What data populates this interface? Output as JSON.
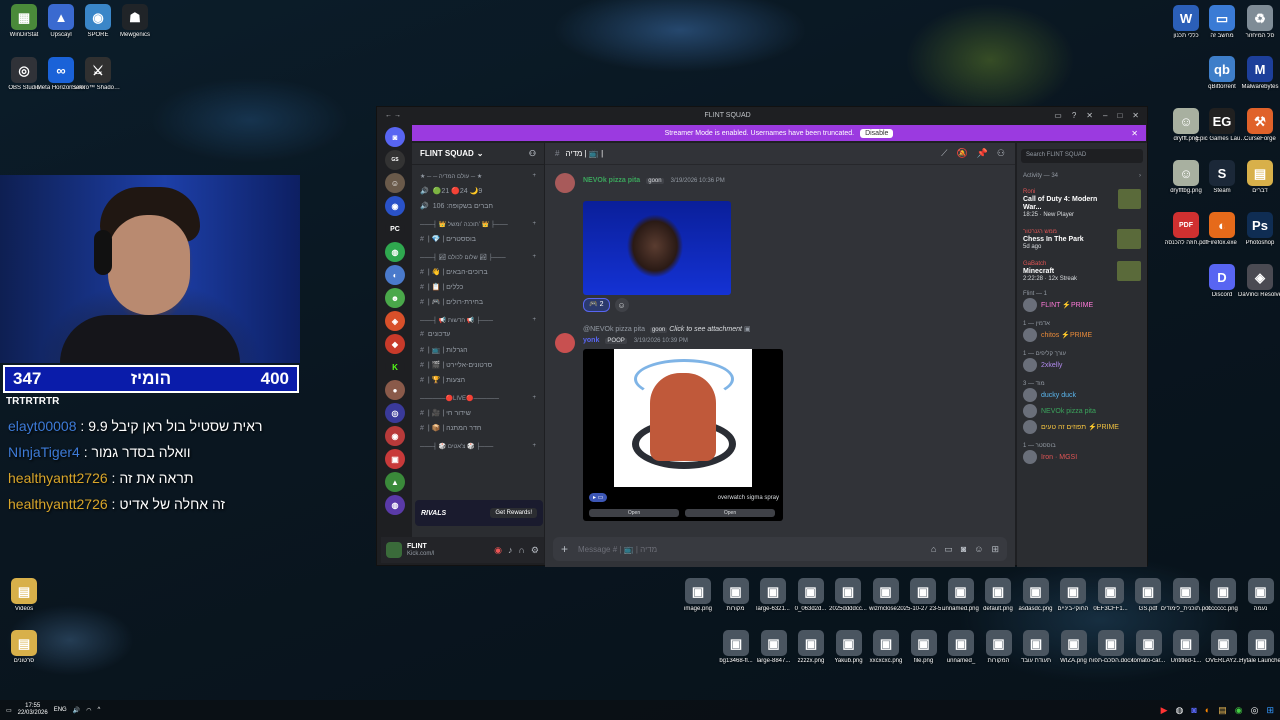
{
  "desktop_left": [
    {
      "label": "WinDirStat",
      "color": "#4a8a3a",
      "glyph": "▦"
    },
    {
      "label": "Upscayl",
      "color": "#3a6ad0",
      "glyph": "▲"
    },
    {
      "label": "SPORE",
      "color": "#3a86c8",
      "glyph": "◉"
    },
    {
      "label": "Mewgenics",
      "color": "#202428",
      "glyph": "☗"
    }
  ],
  "desktop_left_row2": [
    {
      "label": "OBS Studio",
      "color": "#303238",
      "glyph": "◎"
    },
    {
      "label": "Meta Horizon Link",
      "color": "#1a62d8",
      "glyph": "∞"
    },
    {
      "label": "Sekiro™ Shadows D...",
      "color": "#303030",
      "glyph": "⚔"
    }
  ],
  "desktop_left_bottom": [
    {
      "label": "Videos",
      "color": "#d8b04a",
      "glyph": "▤"
    },
    {
      "label": "סרטונים",
      "color": "#d8b04a",
      "glyph": "▤"
    }
  ],
  "desktop_right": [
    {
      "label": "כללי תכנון",
      "color": "#2b5fb8",
      "glyph": "W"
    },
    {
      "label": "מחשב זה",
      "color": "#3a7bd5",
      "glyph": "▭"
    },
    {
      "label": "סל המיחזור",
      "color": "#7f8c96",
      "glyph": "♻"
    },
    {
      "label": "qBittorrent",
      "color": "#3e7ec9",
      "glyph": "qb"
    },
    {
      "label": "Malwarebytes",
      "color": "#1d3f9a",
      "glyph": "M"
    },
    {
      "label": "dryfft.png",
      "color": "#a8b0a0",
      "glyph": "☺"
    },
    {
      "label": "Epic Games Launcher",
      "color": "#202020",
      "glyph": "EG"
    },
    {
      "label": "CurseForge",
      "color": "#e0622a",
      "glyph": "⚒"
    },
    {
      "label": "dryfftbg.png",
      "color": "#a8b0a0",
      "glyph": "☺"
    },
    {
      "label": "Steam",
      "color": "#1b2838",
      "glyph": "S"
    },
    {
      "label": "דברים",
      "color": "#d8b04a",
      "glyph": "▤"
    },
    {
      "label": "חוזה להכנסה.pdf",
      "color": "#d03030",
      "glyph": "PDF"
    },
    {
      "label": "Firefox.exe",
      "color": "#e66a1a",
      "glyph": "◐"
    },
    {
      "label": "Photoshop",
      "color": "#0f2d53",
      "glyph": "Ps"
    },
    {
      "label": "Discord",
      "color": "#5865f2",
      "glyph": "D"
    },
    {
      "label": "DaVinci Resolve",
      "color": "#4a4a52",
      "glyph": "◈"
    }
  ],
  "webcam": {
    "score_left": "347",
    "score_right": "400",
    "score_title": "הומיז",
    "tag": "TRTRTRTR"
  },
  "chat_lines": [
    {
      "user": "elayt00008",
      "color": "#3d7bd8",
      "text": " : ראית שסטיל בול ראן קיבל 9.9"
    },
    {
      "user": "NInjaTiger4",
      "color": "#3d7bd8",
      "text": " : וואלה בסדר גמור"
    },
    {
      "user": "healthyantt2726",
      "color": "#d8a52a",
      "text": " : תראה את זה"
    },
    {
      "user": "healthyantt2726",
      "color": "#d8a52a",
      "text": " : זה אחלה של אדיט"
    }
  ],
  "discord": {
    "window_title": "FLINT SQUAD",
    "banner_text": "Streamer Mode is enabled. Usernames have been truncated.",
    "banner_button": "Disable",
    "server_name": "FLINT SQUAD",
    "channel_header": "מדיה | 📺 |",
    "search_placeholder": "Search FLINT SQUAD",
    "composer_placeholder": "Message # | 📺 | מדיה",
    "categories": [
      {
        "name": "★ ─ ─ עולם המדיה ─ ★",
        "channels": [
          {
            "name": "🟢21 🔴24 🌙9",
            "type": "voice"
          },
          {
            "name": "חברים בשקופה: 106",
            "type": "voice"
          }
        ]
      },
      {
        "name": "───┤ 👑 תוכנה 'ומשל' 👑 ├───",
        "channels": [
          {
            "name": "| 💎 | בוססטרים",
            "type": "text"
          }
        ]
      },
      {
        "name": "───┤ 🏞 שלום לכולם 🏞 ├───",
        "channels": [
          {
            "name": "| 👋 | ברוכים-הבאים",
            "type": "text"
          },
          {
            "name": "| 📋 | כללים",
            "type": "text"
          },
          {
            "name": "| 🎮 | בחירת-רולים",
            "type": "text"
          }
        ]
      },
      {
        "name": "───┤ 📢 חדשות 📢 ├───",
        "channels": [
          {
            "name": "עדכונים",
            "type": "text"
          },
          {
            "name": "| 📺 | הגרלות",
            "type": "text"
          },
          {
            "name": "| 🎬 | סרטונים-אליירט",
            "type": "text"
          },
          {
            "name": "| 🏆 | הצעות",
            "type": "text"
          }
        ]
      },
      {
        "name": "──────🔴LIVE🔴──────",
        "channels": [
          {
            "name": "| 🎥 | שידור חי",
            "type": "text"
          },
          {
            "name": "| 📦 | חדר המתנה",
            "type": "text"
          }
        ]
      },
      {
        "name": "───┤ 🎲 צ'אטים 🎲 ├───",
        "channels": []
      }
    ],
    "rivals_card": {
      "label": "RIVALS",
      "button": "Get Rewards!"
    },
    "user": {
      "name": "FLINT",
      "status": "Kick.com/l"
    },
    "messages": [
      {
        "author": "NEVOk pizza pita",
        "author_color": "#3ba55c",
        "tag": "goon",
        "time": "3/19/2026 10:36 PM"
      },
      {
        "reply_to": "@NEVOk pizza pita",
        "reply_tag": "goon",
        "reply_cta": "Click to see attachment",
        "author": "yonk",
        "author_color": "#5865f2",
        "tag": "POOP",
        "time": "3/19/2026 10:39 PM",
        "embed_caption": "overwatch sigma spray",
        "embed_button": "Open"
      }
    ],
    "reactions": [
      {
        "emoji": "🎮",
        "count": "2"
      }
    ],
    "activity_title": "Activity — 34",
    "activities": [
      {
        "user": "Roni",
        "game": "Call of Duty 4: Modern War...",
        "detail": "18:25 · New Player"
      },
      {
        "user": "ממש רגנרטור",
        "game": "Chess In The Park",
        "detail": "5d ago"
      },
      {
        "user": "GaBatch",
        "game": "Minecraft",
        "detail": "2:22:28 · 12x Streak"
      }
    ],
    "member_sections": [
      {
        "title": "Flint — 1",
        "members": [
          {
            "name": "FLINT ⚡PRIME",
            "color": "#ff7ad9"
          }
        ]
      },
      {
        "title": "אדמין — 1",
        "members": [
          {
            "name": "chitos ⚡PRIME",
            "color": "#e88a3a"
          }
        ]
      },
      {
        "title": "עורך קליפים — 1",
        "members": [
          {
            "name": "2xkelly",
            "color": "#b28bf0"
          }
        ]
      },
      {
        "title": "מוד — 3",
        "members": [
          {
            "name": "ducky duck",
            "color": "#5bb8f0"
          },
          {
            "name": "NEVOk pizza pita",
            "color": "#3ba55c"
          },
          {
            "name": "תפוזים זה טעים ⚡PRIME",
            "color": "#f0c040"
          }
        ]
      },
      {
        "title": "בוססטר — 1",
        "members": [
          {
            "name": "Iron · MGSI",
            "color": "#e05555"
          }
        ]
      }
    ]
  },
  "desktop_bottom": [
    "image.png",
    "מקורות",
    "large-6321...",
    "0_063d2d...",
    "2025ddddcc...",
    "wizmclose...",
    "2025-10-27 23-54-58...",
    "unnamed.png",
    "default.png",
    "asdasdc.png",
    "החוקי-ביניים",
    "0EF3CFF1...",
    "GS.pdf",
    "תוכנית_לימודים.pdf",
    "cccccc.png",
    "נעמה"
  ],
  "desktop_bottom2": [
    "bg13468-fl...",
    "large-8847...",
    "zzzzx.png",
    "Yakub.png",
    "xxcxcxc.png",
    "file.png",
    "unnamed_",
    "המקורות",
    "תעודת עובד",
    "WIZA.png",
    "הסכם-תפוח.docx",
    "tomato-car...",
    "Untitled-1...",
    "OVERLAY2...",
    "Hytale Launcher"
  ],
  "taskbar": {
    "time": "17:55",
    "date": "22/03/2026",
    "lang": "ENG"
  }
}
